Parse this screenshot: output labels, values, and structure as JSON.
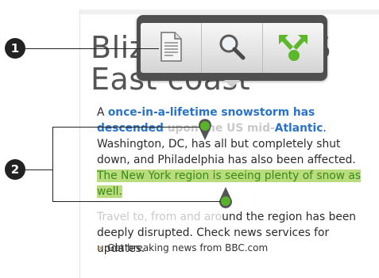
{
  "callouts": {
    "one": "1",
    "two": "2"
  },
  "headline": {
    "line1": "Blizzard hits US",
    "line2": "East coast"
  },
  "article": {
    "p1_intro": "A ",
    "p1_link_visible": "once-in-a-lifetime snowstorm has descended",
    "p1_link_faded": "upon the US mid-",
    "p1_link_end": "Atlantic",
    "p1_rest": ". Washington, DC, has all but completely shut down, and Philadelphia has also been affected. ",
    "p1_selected": "The New York region is seeing plenty of snow as well.",
    "p2_faded": "Travel to, from and aro",
    "p2_rest": "und the region has been deeply disrupted. Check news services for updates."
  },
  "breaking": {
    "arrow": "›",
    "text": "Get breaking news from BBC.com"
  },
  "toolbar": {
    "buttons": [
      {
        "icon": "copy-document-icon"
      },
      {
        "icon": "search-magnifier-icon"
      },
      {
        "icon": "share-arrows-icon"
      }
    ]
  },
  "colors": {
    "link": "#2a73c8",
    "selection_bg": "#b8dc7e",
    "selection_text": "#3c8a16",
    "handle": "#58b22a",
    "share_icon": "#5cb82a"
  }
}
